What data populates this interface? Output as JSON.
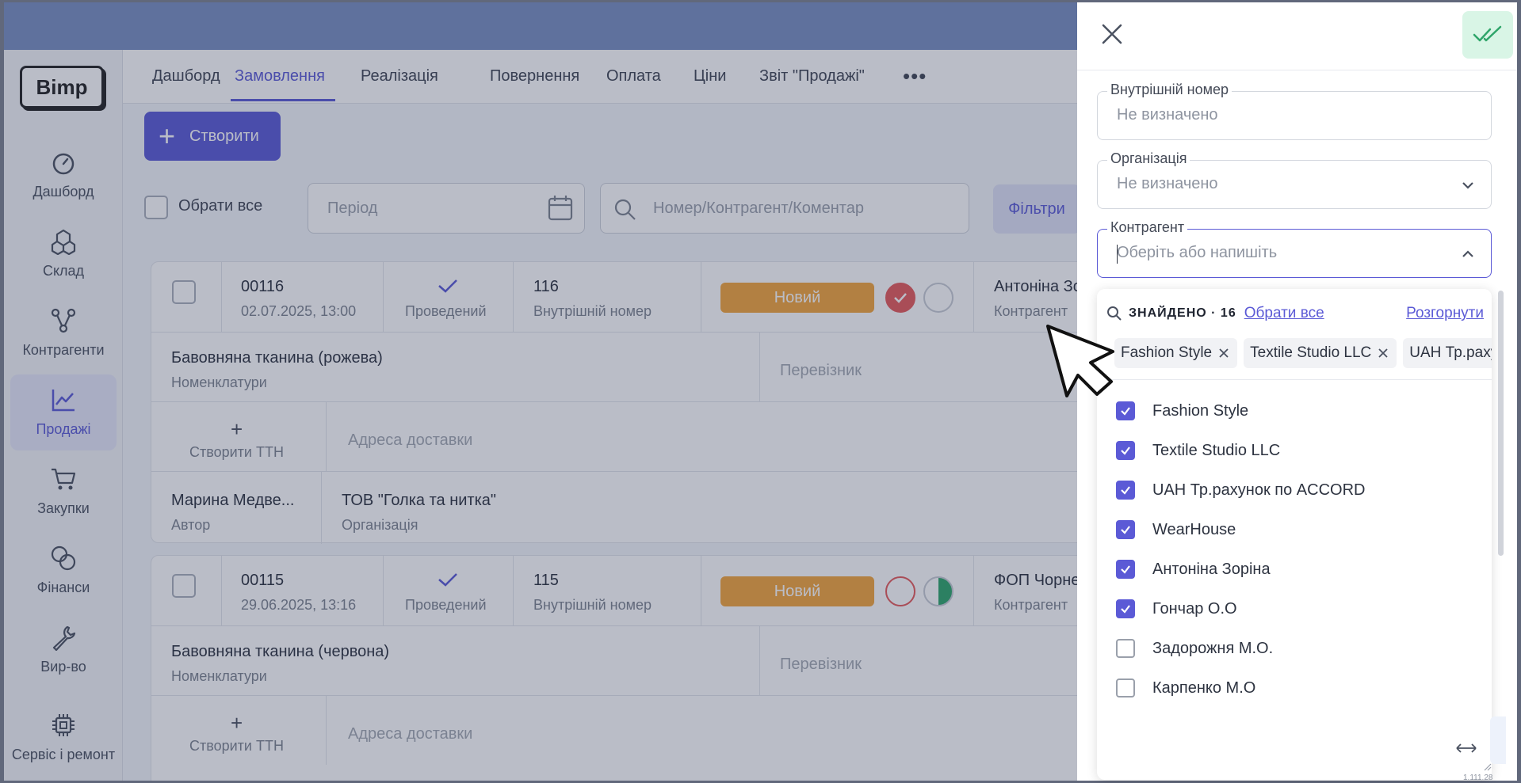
{
  "app": {
    "logo": "Bimp",
    "sidebar": [
      {
        "label": "Дашборд",
        "icon": "gauge-icon"
      },
      {
        "label": "Склад",
        "icon": "boxes-icon"
      },
      {
        "label": "Контрагенти",
        "icon": "network-icon"
      },
      {
        "label": "Продажі",
        "icon": "chart-line-icon",
        "active": true
      },
      {
        "label": "Закупки",
        "icon": "cart-icon"
      },
      {
        "label": "Фінанси",
        "icon": "coins-icon"
      },
      {
        "label": "Вир-во",
        "icon": "wrench-icon"
      },
      {
        "label": "Сервіс і ремонт",
        "icon": "chip-icon"
      }
    ],
    "tabs": [
      "Дашборд",
      "Замовлення",
      "Реалізація",
      "Повернення",
      "Оплата",
      "Ціни",
      "Звіт \"Продажі\""
    ],
    "active_tab": "Замовлення",
    "create_label": "Створити",
    "select_all_label": "Обрати все",
    "period_placeholder": "Період",
    "search_placeholder": "Номер/Контрагент/Коментар",
    "filters_label": "Фільтри",
    "orders": [
      {
        "number": "00116",
        "datetime": "02.07.2025, 13:00",
        "status": "Проведений",
        "internal_number": "116",
        "internal_label": "Внутрішній номер",
        "badge": "Новий",
        "counterparty": "Антоніна Зо",
        "counterparty_label": "Контрагент",
        "product": "Бавовняна тканина (рожева)",
        "product_label": "Номенклатури",
        "carrier_placeholder": "Перевізник",
        "create_ttn": "Створити ТТН",
        "address_placeholder": "Адреса доставки",
        "author": "Марина Медве...",
        "author_label": "Автор",
        "organization": "ТОВ \"Голка та нитка\"",
        "organization_label": "Організація"
      },
      {
        "number": "00115",
        "datetime": "29.06.2025, 13:16",
        "status": "Проведений",
        "internal_number": "115",
        "internal_label": "Внутрішній номер",
        "badge": "Новий",
        "counterparty": "ФОП Чорне",
        "counterparty_label": "Контрагент",
        "product": "Бавовняна тканина (червона)",
        "product_label": "Номенклатури",
        "carrier_placeholder": "Перевізник",
        "create_ttn": "Створити ТТН",
        "address_placeholder": "Адреса доставки"
      }
    ]
  },
  "drawer": {
    "fields": {
      "internal_number": {
        "label": "Внутрішній номер",
        "value": "Не визначено"
      },
      "organization": {
        "label": "Організація",
        "value": "Не визначено"
      },
      "counterparty": {
        "label": "Контрагент",
        "placeholder": "Оберіть або напишіть"
      }
    },
    "dropdown": {
      "found_label": "ЗНАЙДЕНО · 16",
      "select_all": "Обрати все",
      "expand": "Розгорнути",
      "chips": [
        "Fashion Style",
        "Textile Studio LLC",
        "UAH Тр.рахунок по ACCORD"
      ],
      "options": [
        {
          "label": "Fashion Style",
          "checked": true
        },
        {
          "label": "Textile Studio LLC",
          "checked": true
        },
        {
          "label": "UAH Тр.рахунок по ACCORD",
          "checked": true
        },
        {
          "label": "WearHouse",
          "checked": true
        },
        {
          "label": "Антоніна Зоріна",
          "checked": true
        },
        {
          "label": "Гончар О.О",
          "checked": true
        },
        {
          "label": "Задорожня М.О.",
          "checked": false
        },
        {
          "label": "Карпенко М.О",
          "checked": false
        }
      ]
    },
    "version": "1.111.28"
  },
  "colors": {
    "accent": "#5b5ad6",
    "badge_new": "#f4a53b",
    "save_bg": "#d9f5e6",
    "save_check": "#2fa56a"
  }
}
